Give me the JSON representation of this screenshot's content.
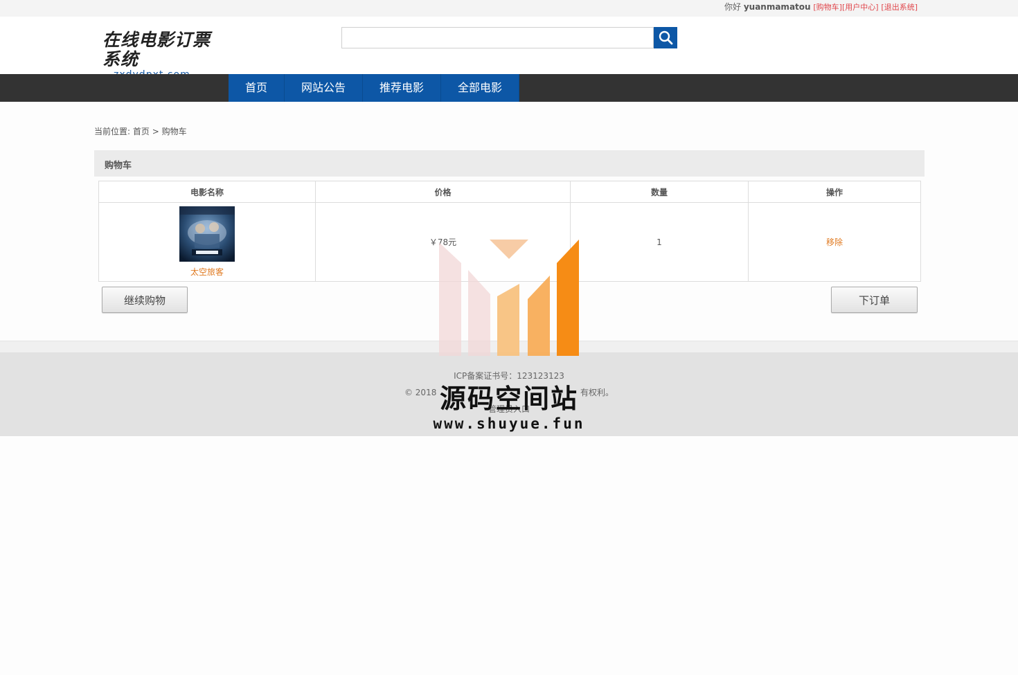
{
  "topbar": {
    "greeting": "你好",
    "username": "yuanmamatou",
    "links": [
      "[购物车]",
      "[用户中心]",
      "[退出系统]"
    ]
  },
  "logo": {
    "title": "在线电影订票系统",
    "domain": "zxdydpxt.com"
  },
  "search": {
    "value": "",
    "icon": "search-icon"
  },
  "nav": {
    "items": [
      "首页",
      "网站公告",
      "推荐电影",
      "全部电影"
    ]
  },
  "breadcrumb": {
    "prefix": "当前位置:",
    "home": "首页",
    "separator": ">",
    "current": "购物车"
  },
  "cart": {
    "title": "购物车",
    "columns": [
      "电影名称",
      "价格",
      "数量",
      "操作"
    ],
    "rows": [
      {
        "name": "太空旅客",
        "price": "￥78元",
        "quantity": "1",
        "action": "移除"
      }
    ],
    "continue_label": "继续购物",
    "order_label": "下订单"
  },
  "footer": {
    "icp": "ICP备案证书号：123123123",
    "copyright_left": "© 2018",
    "copyright_right": "有权利。",
    "admin": "管理员入口"
  },
  "watermark": {
    "text": "源码空间站",
    "url": "www.shuyue.fun"
  },
  "colors": {
    "brand_blue": "#0d57a6",
    "nav_bg": "#333333",
    "link_orange": "#e07a21",
    "link_red": "#e0454a"
  }
}
